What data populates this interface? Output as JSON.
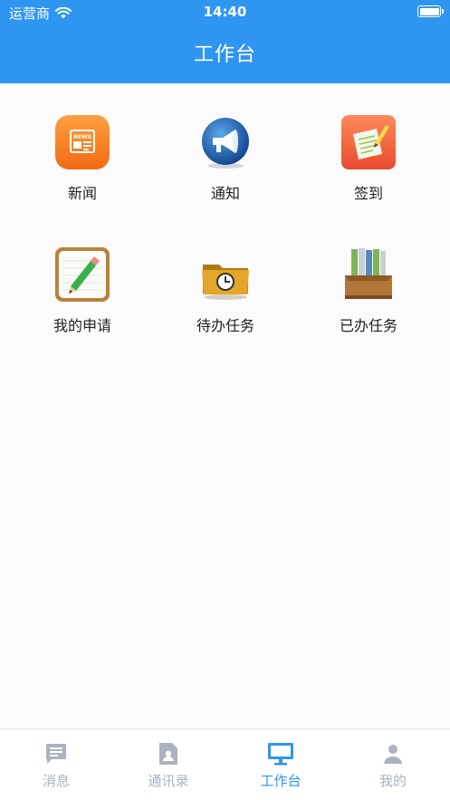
{
  "status_bar": {
    "carrier": "运营商",
    "time": "14:40"
  },
  "header": {
    "title": "工作台"
  },
  "grid": [
    {
      "label": "新闻",
      "icon": "news-icon"
    },
    {
      "label": "通知",
      "icon": "megaphone-icon"
    },
    {
      "label": "签到",
      "icon": "sign-in-icon"
    },
    {
      "label": "我的申请",
      "icon": "pencil-note-icon"
    },
    {
      "label": "待办任务",
      "icon": "clock-folder-icon"
    },
    {
      "label": "已办任务",
      "icon": "binders-icon"
    }
  ],
  "tabbar": [
    {
      "label": "消息",
      "icon": "message-icon",
      "active": false
    },
    {
      "label": "通讯录",
      "icon": "contacts-icon",
      "active": false
    },
    {
      "label": "工作台",
      "icon": "desktop-icon",
      "active": true
    },
    {
      "label": "我的",
      "icon": "person-icon",
      "active": false
    }
  ],
  "colors": {
    "accent": "#2e96f0",
    "tab_inactive": "#aab3bf"
  }
}
